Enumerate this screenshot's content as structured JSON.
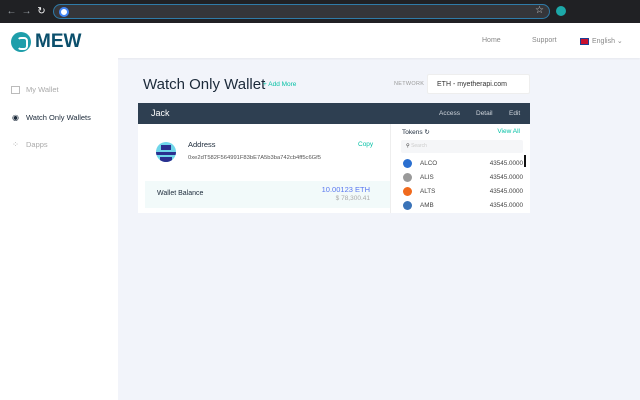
{
  "browser": {
    "address": ""
  },
  "header": {
    "brand": "MEW",
    "nav": [
      "Home",
      "Support"
    ],
    "language": "English"
  },
  "sidebar": {
    "items": [
      {
        "label": "My Wallet"
      },
      {
        "label": "Watch Only Wallets"
      },
      {
        "label": "Dapps"
      }
    ]
  },
  "page": {
    "title": "Watch Only Wallet",
    "add_more": "+ Add More",
    "network_label": "NETWORK",
    "network_value": "ETH - myetherapi.com"
  },
  "wallet": {
    "name": "Jack",
    "actions": [
      "Access",
      "Detail",
      "Edit"
    ],
    "address_label": "Address",
    "address": "0xe2dT582F564991F83bE7A5b3ba742cb4ff5c6Gf5",
    "copy": "Copy",
    "balance_label": "Wallet Balance",
    "balance_eth": "10.00123 ETH",
    "balance_usd": "$ 78,300.41"
  },
  "tokens": {
    "title": "Tokens",
    "view_all": "View All",
    "search_placeholder": "Search",
    "items": [
      {
        "symbol": "ALCO",
        "value": "43545.0000",
        "color": "#2a6fd0"
      },
      {
        "symbol": "ALIS",
        "value": "43545.0000",
        "color": "#9a9a9a"
      },
      {
        "symbol": "ALTS",
        "value": "43545.0000",
        "color": "#f06a1d"
      },
      {
        "symbol": "AMB",
        "value": "43545.0000",
        "color": "#3a73b8"
      }
    ]
  }
}
